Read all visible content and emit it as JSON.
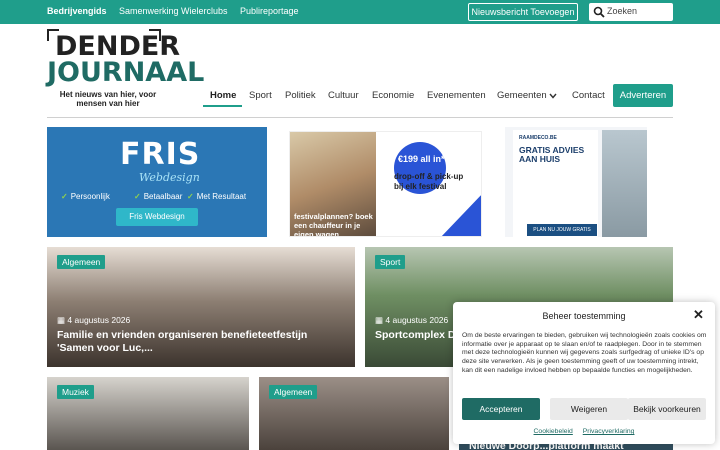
{
  "topbar": {
    "links": [
      "Bedrijvengids",
      "Samenwerking Wielerclubs",
      "Publireportage"
    ],
    "newsletter_label": "Nieuwsbericht Toevoegen",
    "search_placeholder": "Zoeken"
  },
  "logo": {
    "line1": "DENDER",
    "line2": "JOURNAAL",
    "tagline": "Het nieuws van hier, voor mensen van hier"
  },
  "nav": {
    "items": [
      "Home",
      "Sport",
      "Politiek",
      "Cultuur",
      "Economie",
      "Evenementen",
      "Gemeenten",
      "Contact"
    ],
    "active": "Home",
    "cta": "Adverteren"
  },
  "ads": {
    "fris": {
      "brand": "FRIS",
      "sub": "Webdesign",
      "features": [
        "Persoonlijk",
        "Betaalbaar",
        "Met Resultaat"
      ],
      "button": "Fris Webdesign"
    },
    "festival": {
      "price": "€199 all in*",
      "line1": "drop-off & pick-up",
      "line2": "bij elk festival",
      "photo_text": "festivalplannen? boek een chauffeur in je eigen wagen"
    },
    "raamdeco": {
      "brand": "RAAMDECO.BE",
      "headline": "GRATIS ADVIES AAN HUIS",
      "button": "PLAN NU JOUW GRATIS AFSPRAAK"
    }
  },
  "articles": [
    {
      "category": "Algemeen",
      "date": "4 augustus 2026",
      "title": "Familie en vrienden organiseren benefieteetfestijn 'Samen voor Luc,..."
    },
    {
      "category": "Sport",
      "date": "4 augustus 2026",
      "title": "Sportcomplex D... sportseizoen no..."
    },
    {
      "category": "Muziek",
      "date": "",
      "title": ""
    },
    {
      "category": "Algemeen",
      "date": "",
      "title": ""
    },
    {
      "category": "",
      "date": "",
      "title": "Nieuwe Doorp...platform maakt"
    }
  ],
  "consent": {
    "title": "Beheer toestemming",
    "text": "Om de beste ervaringen te bieden, gebruiken wij technologieën zoals cookies om informatie over je apparaat op te slaan en/of te raadplegen. Door in te stemmen met deze technologieën kunnen wij gegevens zoals surfgedrag of unieke ID's op deze site verwerken. Als je geen toestemming geeft of uw toestemming intrekt, kan dit een nadelige invloed hebben op bepaalde functies en mogelijkheden.",
    "accept": "Accepteren",
    "deny": "Weigeren",
    "prefs": "Bekijk voorkeuren",
    "link1": "Cookiebeleid",
    "link2": "Privacyverklaring"
  },
  "colors": {
    "accent": "#1f9e8b",
    "dark_accent": "#1f6b64"
  }
}
